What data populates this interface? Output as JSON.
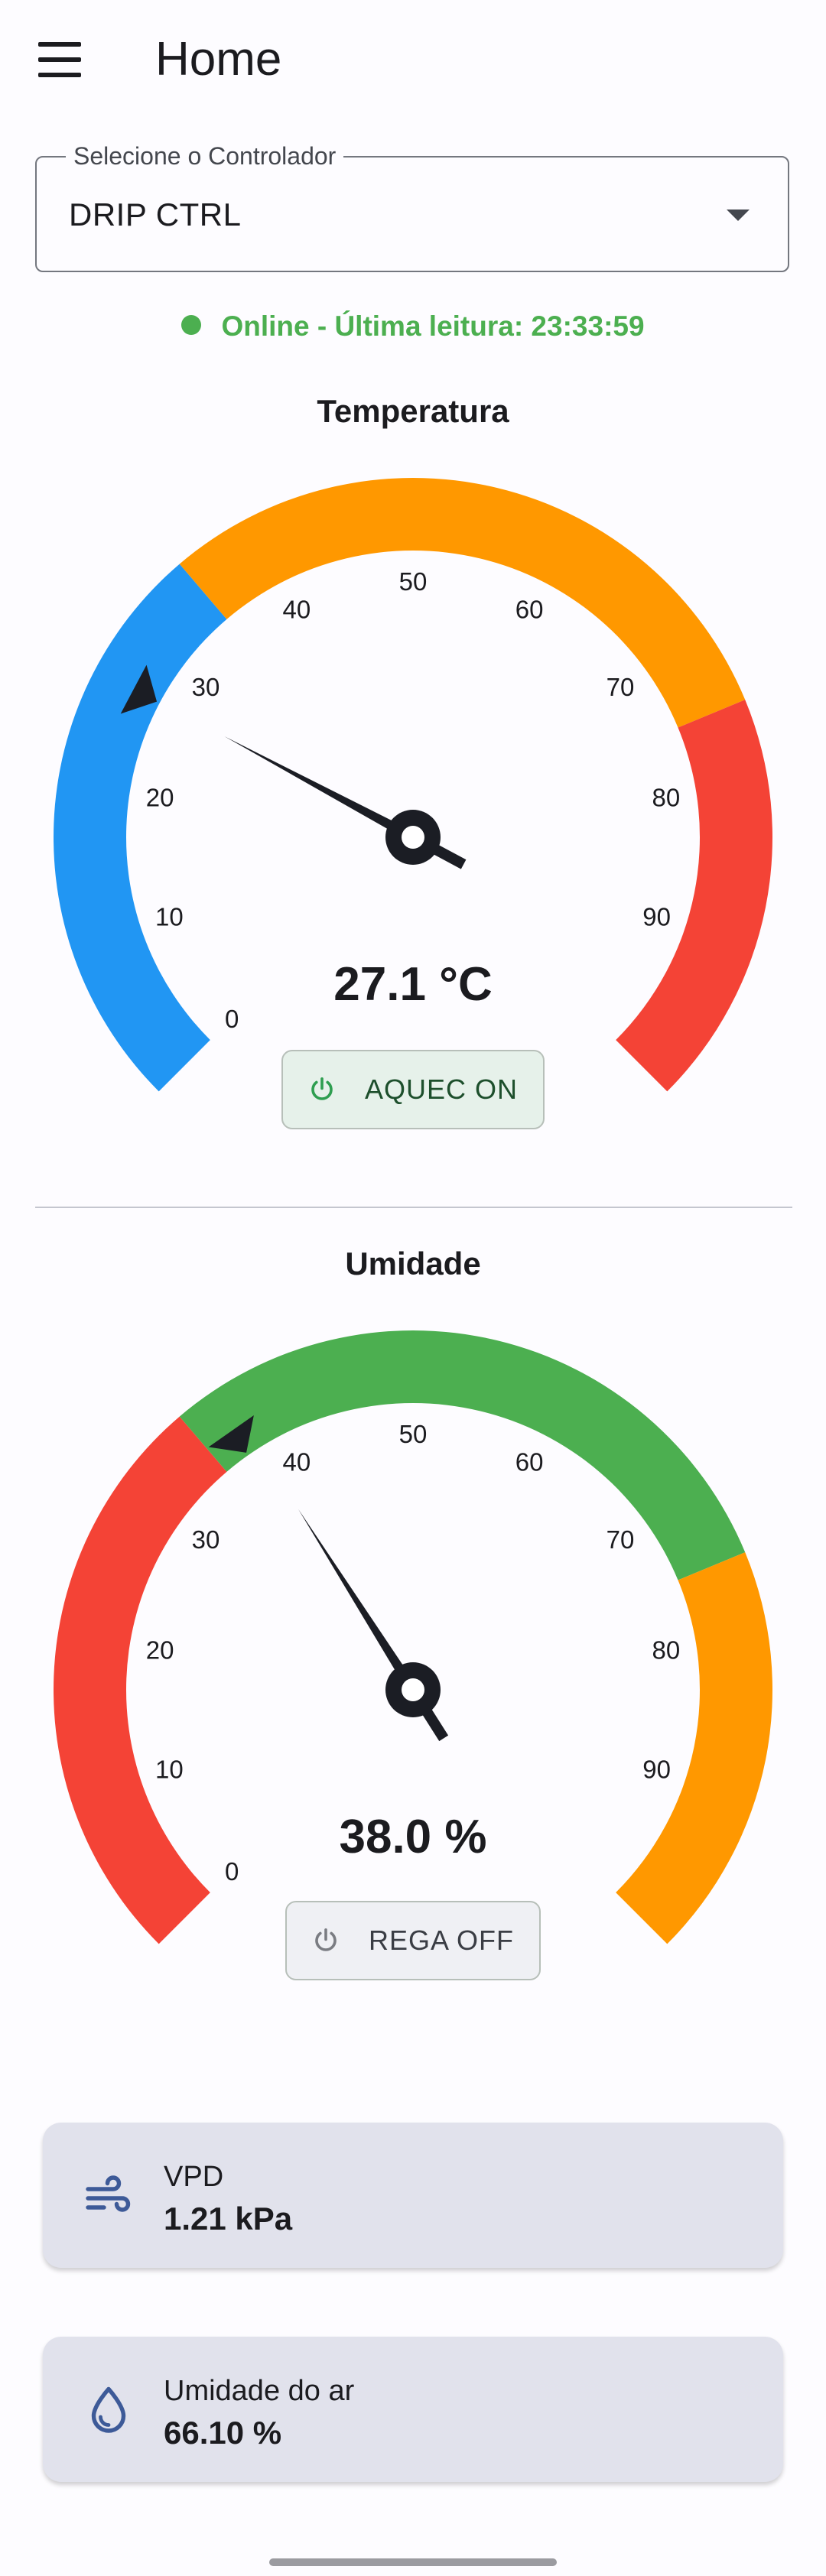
{
  "appbar": {
    "title": "Home",
    "menu_icon": "menu-icon"
  },
  "controller_select": {
    "label": "Selecione o Controlador",
    "value": "DRIP CTRL",
    "icon": "arrow-drop-down-icon"
  },
  "status": {
    "text": "Online - Última leitura: 23:33:59",
    "color": "#4caf50"
  },
  "gauges": [
    {
      "title": "Temperatura",
      "value": 27.1,
      "value_text": "27.1 °C",
      "setpoint": 27,
      "min": 0,
      "max": 100,
      "tick_labels": [
        "0",
        "10",
        "20",
        "30",
        "40",
        "50",
        "60",
        "70",
        "80",
        "90"
      ],
      "bands": [
        {
          "from": 0,
          "to": 35,
          "color": "#2196f3"
        },
        {
          "from": 35,
          "to": 75,
          "color": "#ff9800"
        },
        {
          "from": 75,
          "to": 100,
          "color": "#f44336"
        }
      ],
      "button": {
        "label": "AQUEC ON",
        "icon": "power-icon",
        "state": "on"
      }
    },
    {
      "title": "Umidade",
      "value": 38.0,
      "value_text": "38.0 %",
      "setpoint": 37,
      "min": 0,
      "max": 100,
      "tick_labels": [
        "0",
        "10",
        "20",
        "30",
        "40",
        "50",
        "60",
        "70",
        "80",
        "90"
      ],
      "bands": [
        {
          "from": 0,
          "to": 35,
          "color": "#f44336"
        },
        {
          "from": 35,
          "to": 75,
          "color": "#4caf50"
        },
        {
          "from": 75,
          "to": 100,
          "color": "#ff9800"
        }
      ],
      "button": {
        "label": "REGA OFF",
        "icon": "power-icon",
        "state": "off"
      }
    }
  ],
  "cards": [
    {
      "icon": "air-icon",
      "label": "VPD",
      "value": "1.21 kPa"
    },
    {
      "icon": "water-drop-icon",
      "label": "Umidade do ar",
      "value": "66.10 %"
    }
  ],
  "colors": {
    "needle": "#1b1d24",
    "icon_blue": "#3d5a98"
  }
}
